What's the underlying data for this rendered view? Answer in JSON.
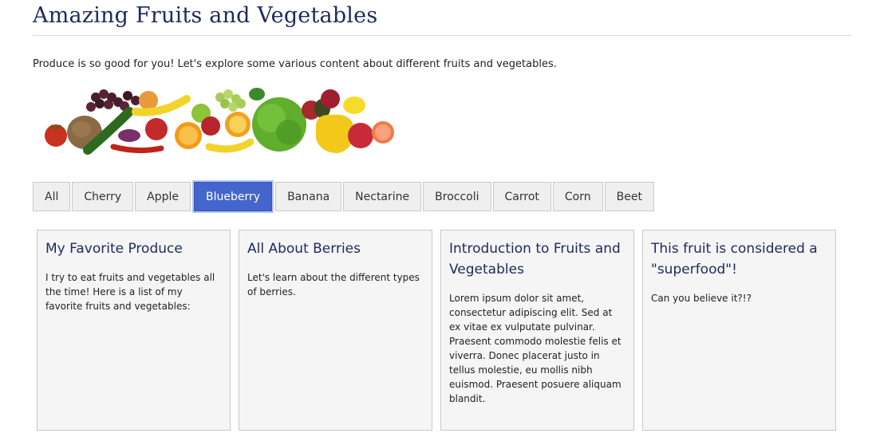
{
  "page": {
    "title": "Amazing Fruits and Vegetables",
    "intro": "Produce is so good for you! Let's explore some various content about different fruits and vegetables."
  },
  "hero_image": {
    "alt": "fruits-and-vegetables-pile"
  },
  "tabs": [
    {
      "label": "All",
      "active": false
    },
    {
      "label": "Cherry",
      "active": false
    },
    {
      "label": "Apple",
      "active": false
    },
    {
      "label": "Blueberry",
      "active": true
    },
    {
      "label": "Banana",
      "active": false
    },
    {
      "label": "Nectarine",
      "active": false
    },
    {
      "label": "Broccoli",
      "active": false
    },
    {
      "label": "Carrot",
      "active": false
    },
    {
      "label": "Corn",
      "active": false
    },
    {
      "label": "Beet",
      "active": false
    }
  ],
  "cards": [
    {
      "title": "My Favorite Produce",
      "body": "I try to eat fruits and vegetables all the time! Here is a list of my favorite fruits and vegetables:"
    },
    {
      "title": "All About Berries",
      "body": "Let's learn about the different types of berries."
    },
    {
      "title": "Introduction to Fruits and Vegetables",
      "body": "Lorem ipsum dolor sit amet, consectetur adipiscing elit. Sed at ex vitae ex vulputate pulvinar. Praesent commodo molestie felis et viverra. Donec placerat justo in tellus molestie, eu mollis nibh euismod. Praesent posuere aliquam blandit."
    },
    {
      "title": "This fruit is considered a \"superfood\"!",
      "body": "Can you believe it?!?"
    }
  ],
  "colors": {
    "heading": "#1e2a5a",
    "active_tab": "#4466cc",
    "tab_bg": "#efefef",
    "card_bg": "#f5f5f5"
  }
}
